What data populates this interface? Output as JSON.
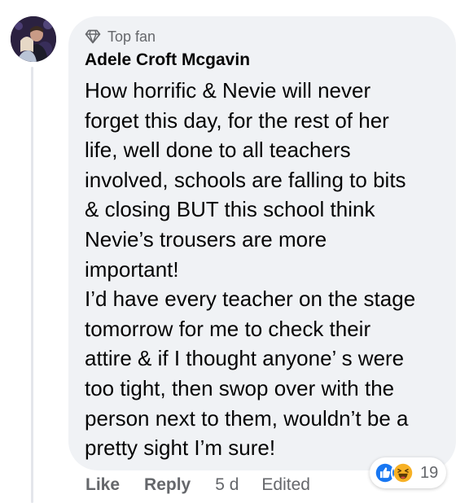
{
  "comment": {
    "badge": {
      "icon": "diamond-icon",
      "label": "Top fan"
    },
    "author": "Adele Croft Mcgavin",
    "text_lines": [
      "How horrific & Nevie will never",
      "forget this day, for the rest of her",
      "life, well done to all teachers",
      "involved, schools are falling to bits",
      "& closing BUT this school think",
      "Nevie’s trousers are more",
      "important!",
      "I’d have every teacher on the stage",
      "tomorrow for me to check their",
      "attire & if I thought anyone’ s were",
      "too tight, then swop over with the",
      "person next to them, wouldn’t be a",
      "pretty sight I’m sure!"
    ],
    "reactions": {
      "icons": [
        "like-reaction-icon",
        "haha-reaction-icon"
      ],
      "count": "19"
    },
    "actions": {
      "like": "Like",
      "reply": "Reply",
      "time": "5 d",
      "edited": "Edited"
    }
  },
  "colors": {
    "bubble_bg": "#f0f2f5",
    "secondary_text": "#65676b",
    "primary_text": "#050505",
    "like_blue": "#1877f2",
    "haha_yellow": "#f7b125"
  }
}
